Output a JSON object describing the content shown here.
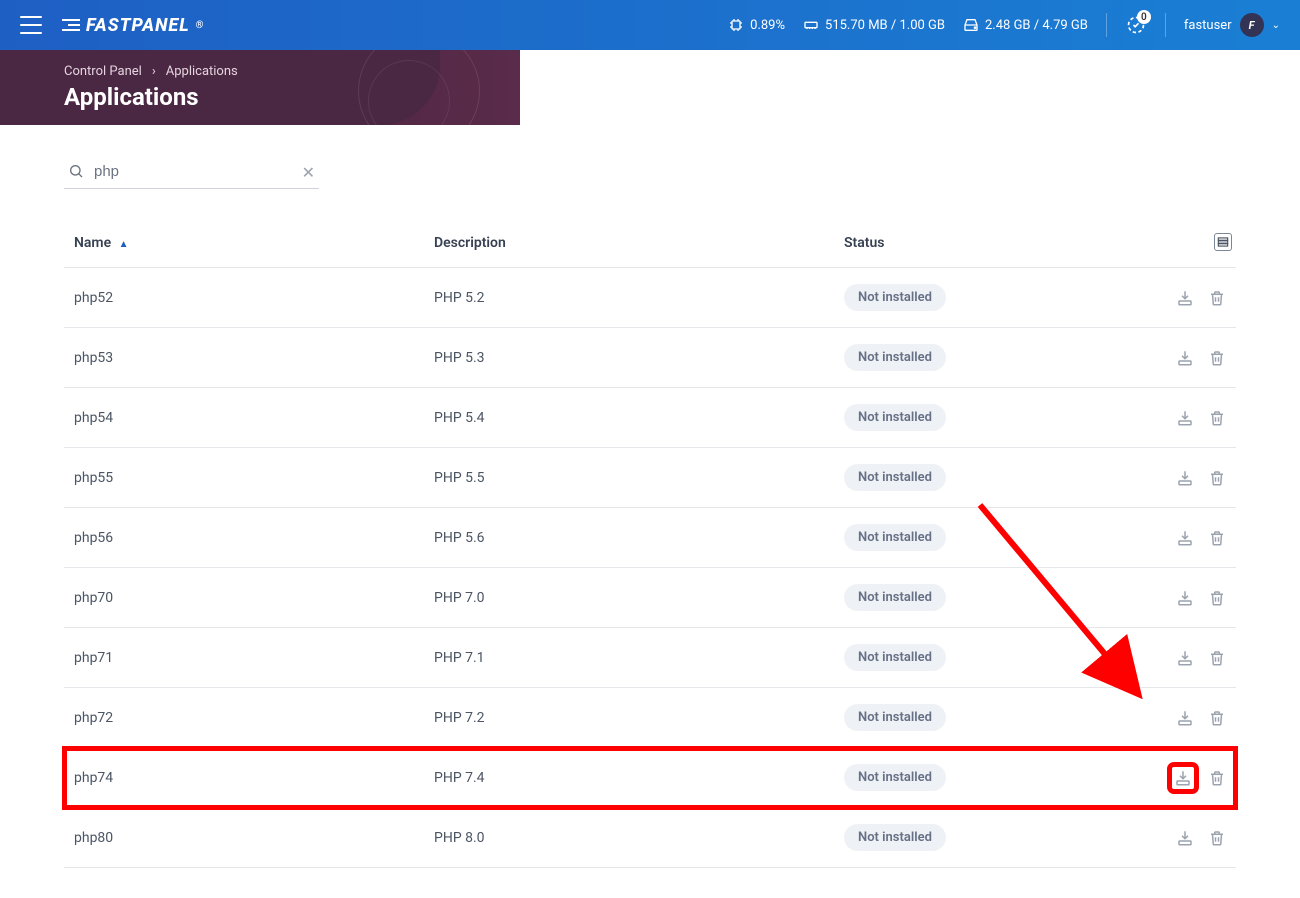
{
  "header": {
    "brand": "FASTPANEL",
    "cpu": "0.89%",
    "ram": "515.70 MB / 1.00 GB",
    "disk": "2.48 GB / 4.79 GB",
    "notif_count": "0",
    "username": "fastuser",
    "avatar_letter": "F"
  },
  "breadcrumb": {
    "root": "Control Panel",
    "sep": "›",
    "current": "Applications"
  },
  "page_title": "Applications",
  "search": {
    "value": "php"
  },
  "columns": {
    "name": "Name",
    "description": "Description",
    "status": "Status"
  },
  "status_label": "Not installed",
  "apps": [
    {
      "name": "php52",
      "desc": "PHP 5.2"
    },
    {
      "name": "php53",
      "desc": "PHP 5.3"
    },
    {
      "name": "php54",
      "desc": "PHP 5.4"
    },
    {
      "name": "php55",
      "desc": "PHP 5.5"
    },
    {
      "name": "php56",
      "desc": "PHP 5.6"
    },
    {
      "name": "php70",
      "desc": "PHP 7.0"
    },
    {
      "name": "php71",
      "desc": "PHP 7.1"
    },
    {
      "name": "php72",
      "desc": "PHP 7.2"
    },
    {
      "name": "php74",
      "desc": "PHP 7.4",
      "highlight": true
    },
    {
      "name": "php80",
      "desc": "PHP 8.0"
    }
  ]
}
